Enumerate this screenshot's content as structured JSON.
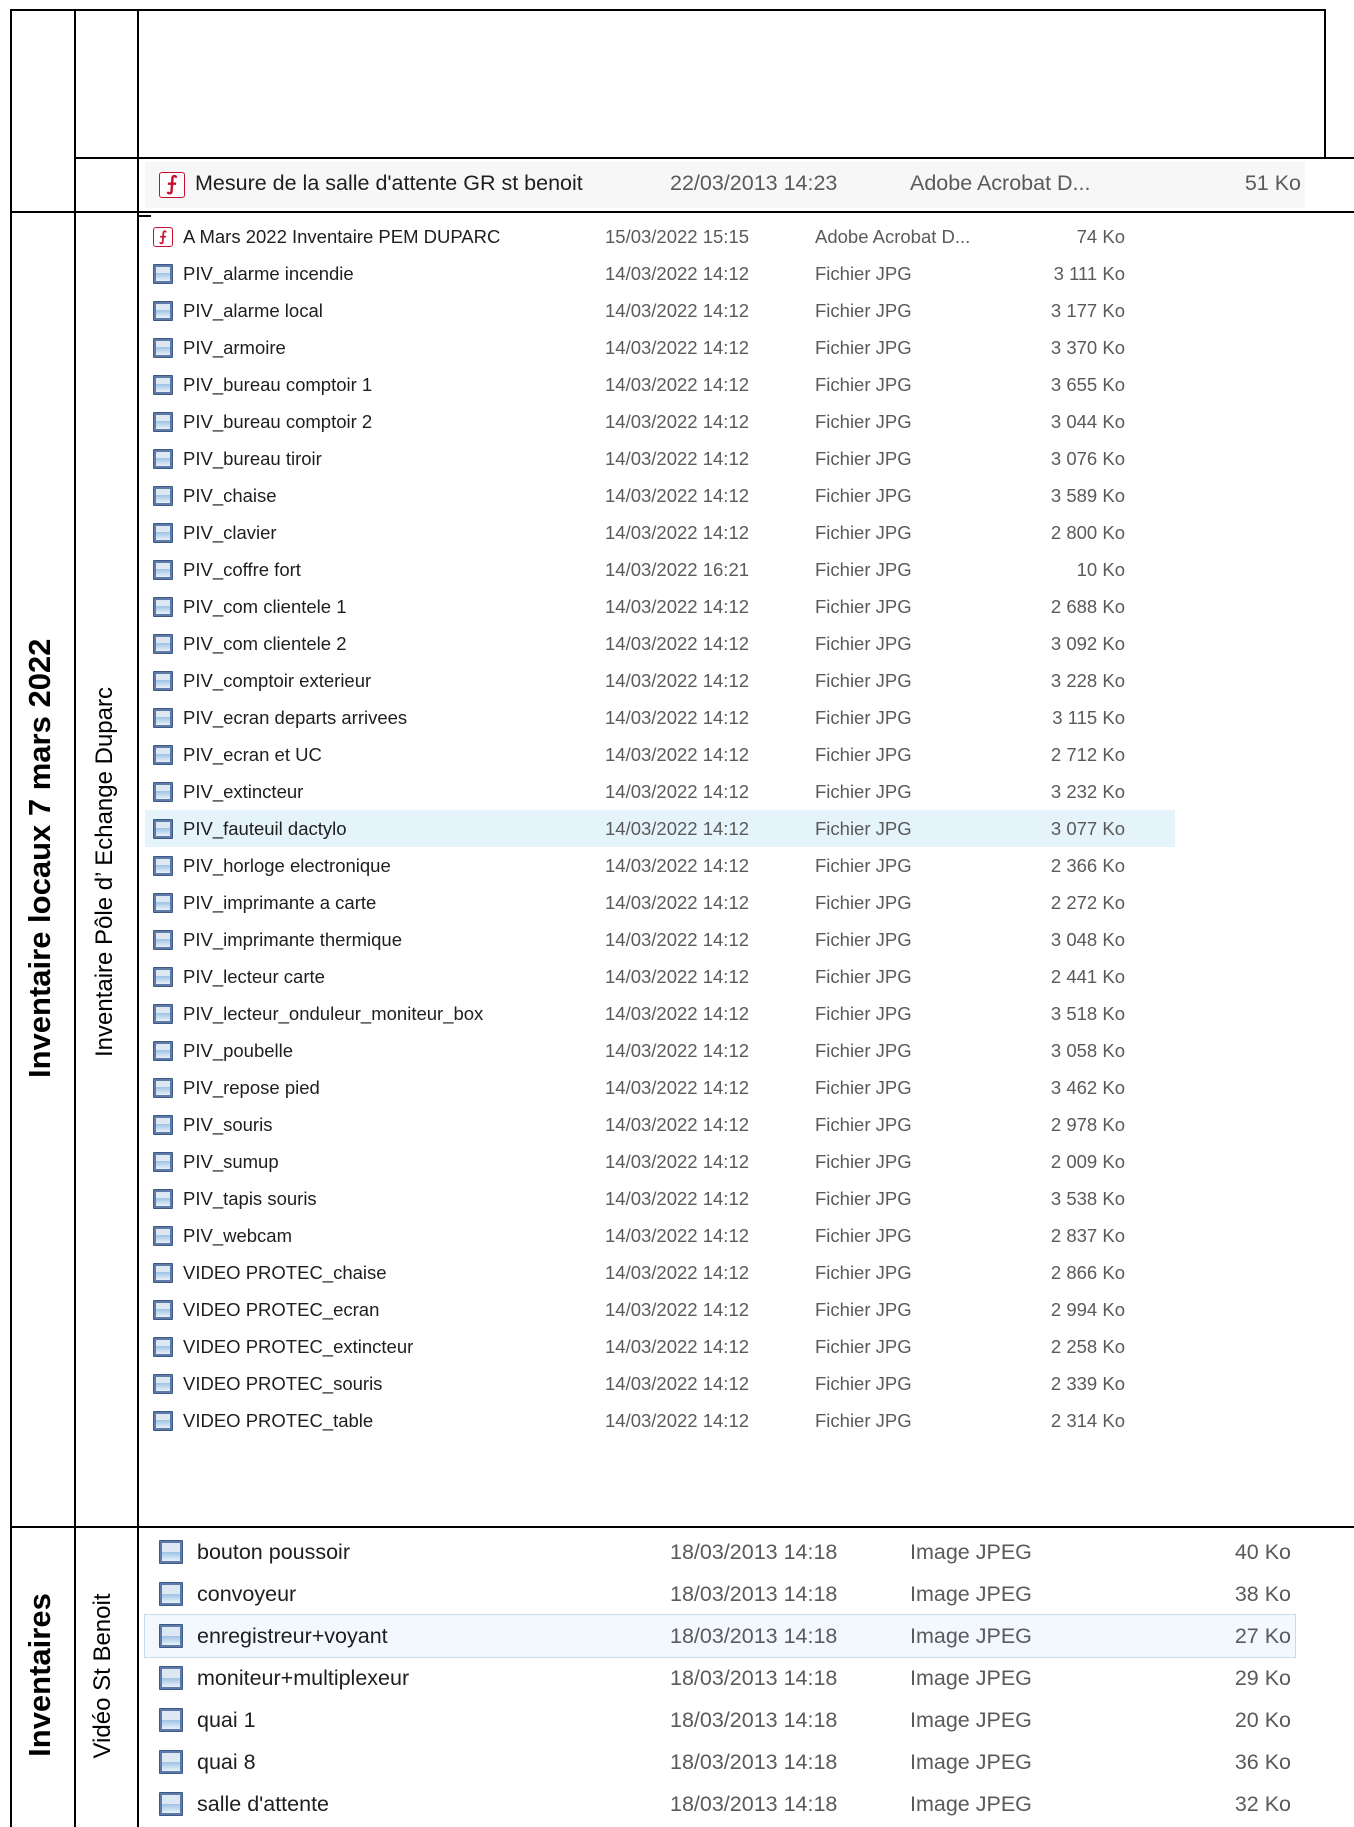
{
  "labels": {
    "section1_outer": "",
    "section1_inner": "",
    "section2_outer": "Inventaire locaux 7 mars 2022",
    "section2_inner": "Inventaire Pôle d’   Echange Duparc",
    "section3_outer": "Inventaires",
    "section3_inner": "Vidéo St Benoit"
  },
  "pane_top": {
    "rows": [
      {
        "name": "Mesure de la salle d'attente GR st benoit",
        "date": "22/03/2013 14:23",
        "type": "Adobe Acrobat D...",
        "size": "51 Ko",
        "icon": "pdf-icon"
      }
    ]
  },
  "pane_mid": {
    "rows": [
      {
        "name": "A Mars 2022 Inventaire PEM DUPARC",
        "date": "15/03/2022 15:15",
        "type": "Adobe Acrobat D...",
        "size": "74 Ko",
        "icon": "pdf-icon"
      },
      {
        "name": "PIV_alarme incendie",
        "date": "14/03/2022 14:12",
        "type": "Fichier JPG",
        "size": "3 111 Ko",
        "icon": "image-icon"
      },
      {
        "name": "PIV_alarme local",
        "date": "14/03/2022 14:12",
        "type": "Fichier JPG",
        "size": "3 177 Ko",
        "icon": "image-icon"
      },
      {
        "name": "PIV_armoire",
        "date": "14/03/2022 14:12",
        "type": "Fichier JPG",
        "size": "3 370 Ko",
        "icon": "image-icon"
      },
      {
        "name": "PIV_bureau comptoir 1",
        "date": "14/03/2022 14:12",
        "type": "Fichier JPG",
        "size": "3 655 Ko",
        "icon": "image-icon"
      },
      {
        "name": "PIV_bureau comptoir 2",
        "date": "14/03/2022 14:12",
        "type": "Fichier JPG",
        "size": "3 044 Ko",
        "icon": "image-icon"
      },
      {
        "name": "PIV_bureau tiroir",
        "date": "14/03/2022 14:12",
        "type": "Fichier JPG",
        "size": "3 076 Ko",
        "icon": "image-icon"
      },
      {
        "name": "PIV_chaise",
        "date": "14/03/2022 14:12",
        "type": "Fichier JPG",
        "size": "3 589 Ko",
        "icon": "image-icon"
      },
      {
        "name": "PIV_clavier",
        "date": "14/03/2022 14:12",
        "type": "Fichier JPG",
        "size": "2 800 Ko",
        "icon": "image-icon"
      },
      {
        "name": "PIV_coffre fort",
        "date": "14/03/2022 16:21",
        "type": "Fichier JPG",
        "size": "10 Ko",
        "icon": "image-icon"
      },
      {
        "name": "PIV_com clientele 1",
        "date": "14/03/2022 14:12",
        "type": "Fichier JPG",
        "size": "2 688 Ko",
        "icon": "image-icon"
      },
      {
        "name": "PIV_com clientele 2",
        "date": "14/03/2022 14:12",
        "type": "Fichier JPG",
        "size": "3 092 Ko",
        "icon": "image-icon"
      },
      {
        "name": "PIV_comptoir exterieur",
        "date": "14/03/2022 14:12",
        "type": "Fichier JPG",
        "size": "3 228 Ko",
        "icon": "image-icon"
      },
      {
        "name": "PIV_ecran departs arrivees",
        "date": "14/03/2022 14:12",
        "type": "Fichier JPG",
        "size": "3 115 Ko",
        "icon": "image-icon"
      },
      {
        "name": "PIV_ecran et UC",
        "date": "14/03/2022 14:12",
        "type": "Fichier JPG",
        "size": "2 712 Ko",
        "icon": "image-icon"
      },
      {
        "name": "PIV_extincteur",
        "date": "14/03/2022 14:12",
        "type": "Fichier JPG",
        "size": "3 232 Ko",
        "icon": "image-icon"
      },
      {
        "name": "PIV_fauteuil dactylo",
        "date": "14/03/2022 14:12",
        "type": "Fichier JPG",
        "size": "3 077 Ko",
        "icon": "image-icon"
      },
      {
        "name": "PIV_horloge electronique",
        "date": "14/03/2022 14:12",
        "type": "Fichier JPG",
        "size": "2 366 Ko",
        "icon": "image-icon"
      },
      {
        "name": "PIV_imprimante a carte",
        "date": "14/03/2022 14:12",
        "type": "Fichier JPG",
        "size": "2 272 Ko",
        "icon": "image-icon"
      },
      {
        "name": "PIV_imprimante thermique",
        "date": "14/03/2022 14:12",
        "type": "Fichier JPG",
        "size": "3 048 Ko",
        "icon": "image-icon"
      },
      {
        "name": "PIV_lecteur carte",
        "date": "14/03/2022 14:12",
        "type": "Fichier JPG",
        "size": "2 441 Ko",
        "icon": "image-icon"
      },
      {
        "name": "PIV_lecteur_onduleur_moniteur_box",
        "date": "14/03/2022 14:12",
        "type": "Fichier JPG",
        "size": "3 518 Ko",
        "icon": "image-icon"
      },
      {
        "name": "PIV_poubelle",
        "date": "14/03/2022 14:12",
        "type": "Fichier JPG",
        "size": "3 058 Ko",
        "icon": "image-icon"
      },
      {
        "name": "PIV_repose pied",
        "date": "14/03/2022 14:12",
        "type": "Fichier JPG",
        "size": "3 462 Ko",
        "icon": "image-icon"
      },
      {
        "name": "PIV_souris",
        "date": "14/03/2022 14:12",
        "type": "Fichier JPG",
        "size": "2 978 Ko",
        "icon": "image-icon"
      },
      {
        "name": "PIV_sumup",
        "date": "14/03/2022 14:12",
        "type": "Fichier JPG",
        "size": "2 009 Ko",
        "icon": "image-icon"
      },
      {
        "name": "PIV_tapis souris",
        "date": "14/03/2022 14:12",
        "type": "Fichier JPG",
        "size": "3 538 Ko",
        "icon": "image-icon"
      },
      {
        "name": "PIV_webcam",
        "date": "14/03/2022 14:12",
        "type": "Fichier JPG",
        "size": "2 837 Ko",
        "icon": "image-icon"
      },
      {
        "name": "VIDEO PROTEC_chaise",
        "date": "14/03/2022 14:12",
        "type": "Fichier JPG",
        "size": "2 866 Ko",
        "icon": "image-icon"
      },
      {
        "name": "VIDEO PROTEC_ecran",
        "date": "14/03/2022 14:12",
        "type": "Fichier JPG",
        "size": "2 994 Ko",
        "icon": "image-icon"
      },
      {
        "name": "VIDEO PROTEC_extincteur",
        "date": "14/03/2022 14:12",
        "type": "Fichier JPG",
        "size": "2 258 Ko",
        "icon": "image-icon"
      },
      {
        "name": "VIDEO PROTEC_souris",
        "date": "14/03/2022 14:12",
        "type": "Fichier JPG",
        "size": "2 339 Ko",
        "icon": "image-icon"
      },
      {
        "name": "VIDEO PROTEC_table",
        "date": "14/03/2022 14:12",
        "type": "Fichier JPG",
        "size": "2 314 Ko",
        "icon": "image-icon"
      }
    ]
  },
  "pane_bottom": {
    "rows": [
      {
        "name": "bouton poussoir",
        "date": "18/03/2013 14:18",
        "type": "Image JPEG",
        "size": "40 Ko",
        "icon": "image-icon"
      },
      {
        "name": "convoyeur",
        "date": "18/03/2013 14:18",
        "type": "Image JPEG",
        "size": "38 Ko",
        "icon": "image-icon"
      },
      {
        "name": "enregistreur+voyant",
        "date": "18/03/2013 14:18",
        "type": "Image JPEG",
        "size": "27 Ko",
        "icon": "image-icon"
      },
      {
        "name": "moniteur+multiplexeur",
        "date": "18/03/2013 14:18",
        "type": "Image JPEG",
        "size": "29 Ko",
        "icon": "image-icon"
      },
      {
        "name": "quai 1",
        "date": "18/03/2013 14:18",
        "type": "Image JPEG",
        "size": "20 Ko",
        "icon": "image-icon"
      },
      {
        "name": "quai 8",
        "date": "18/03/2013 14:18",
        "type": "Image JPEG",
        "size": "36 Ko",
        "icon": "image-icon"
      },
      {
        "name": "salle d'attente",
        "date": "18/03/2013 14:18",
        "type": "Image JPEG",
        "size": "32 Ko",
        "icon": "image-icon"
      }
    ]
  }
}
